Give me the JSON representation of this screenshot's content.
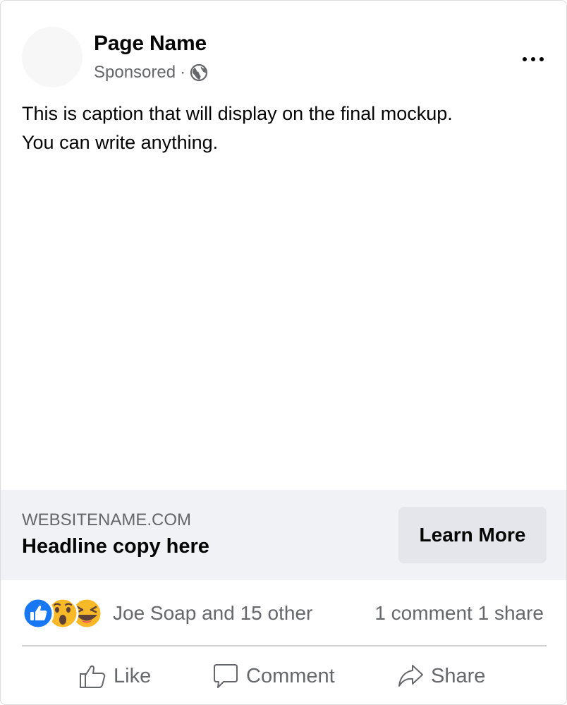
{
  "post": {
    "page_name": "Page Name",
    "sponsored_label": "Sponsored",
    "separator": "·",
    "audience_icon": "globe-icon",
    "more_icon": "ellipsis-icon",
    "caption_line1": "This is caption that will display on the final mockup.",
    "caption_line2": "You can write anything."
  },
  "link_preview": {
    "domain": "WEBSITENAME.COM",
    "headline": "Headline copy here",
    "cta_label": "Learn More"
  },
  "engagement": {
    "reaction_icons": [
      "like-reaction-icon",
      "wow-reaction-icon",
      "haha-reaction-icon"
    ],
    "reaction_text": "Joe Soap and 15 other",
    "counts_text": "1 comment 1 share"
  },
  "actions": {
    "like": "Like",
    "comment": "Comment",
    "share": "Share"
  },
  "colors": {
    "text_primary": "#050505",
    "text_secondary": "#65676b",
    "link_bar_bg": "#f0f2f5",
    "button_bg": "#e4e6eb",
    "like_blue": "#1877f2",
    "emoji_yellow": "#f7b928"
  }
}
